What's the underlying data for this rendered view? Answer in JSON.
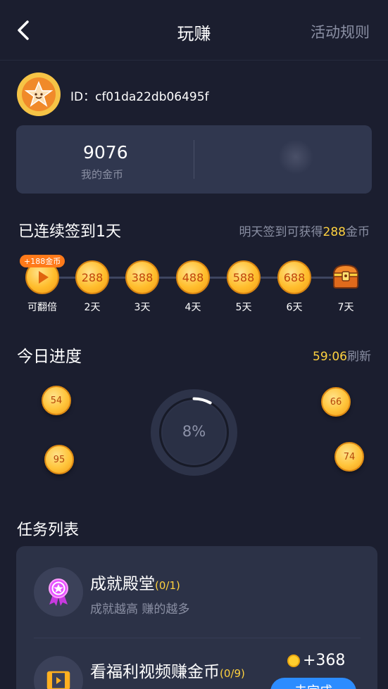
{
  "header": {
    "title": "玩赚",
    "rules": "活动规则"
  },
  "user": {
    "id_text": "ID：cf01da22db06495f"
  },
  "coins": {
    "amount": "9076",
    "label": "我的金币"
  },
  "signin": {
    "title": "已连续签到1天",
    "tip_prefix": "明天签到可获得",
    "tip_amount": "288",
    "tip_suffix": "金币",
    "bonus_badge": "+188金币",
    "days": [
      {
        "value": "",
        "label": "可翻倍"
      },
      {
        "value": "288",
        "label": "2天"
      },
      {
        "value": "388",
        "label": "3天"
      },
      {
        "value": "488",
        "label": "4天"
      },
      {
        "value": "588",
        "label": "5天"
      },
      {
        "value": "688",
        "label": "6天"
      },
      {
        "value": "",
        "label": "7天"
      }
    ]
  },
  "today": {
    "title": "今日进度",
    "countdown": "59:06",
    "refresh": "刷新",
    "progress_text": "8%",
    "progress_fraction": 0.08,
    "coins": [
      "54",
      "66",
      "95",
      "74"
    ]
  },
  "tasks": {
    "title": "任务列表",
    "items": [
      {
        "name": "成就殿堂",
        "progress": "(0/1)",
        "desc": "成就越高 赚的越多"
      },
      {
        "name": "看福利视频赚金币",
        "progress": "(0/9)",
        "reward": "+368",
        "button": "去完成"
      }
    ]
  },
  "colors": {
    "accent_yellow": "#ffd23f",
    "button_blue": "#2c8cff",
    "background": "#1b1e2f",
    "panel": "#30374f"
  }
}
